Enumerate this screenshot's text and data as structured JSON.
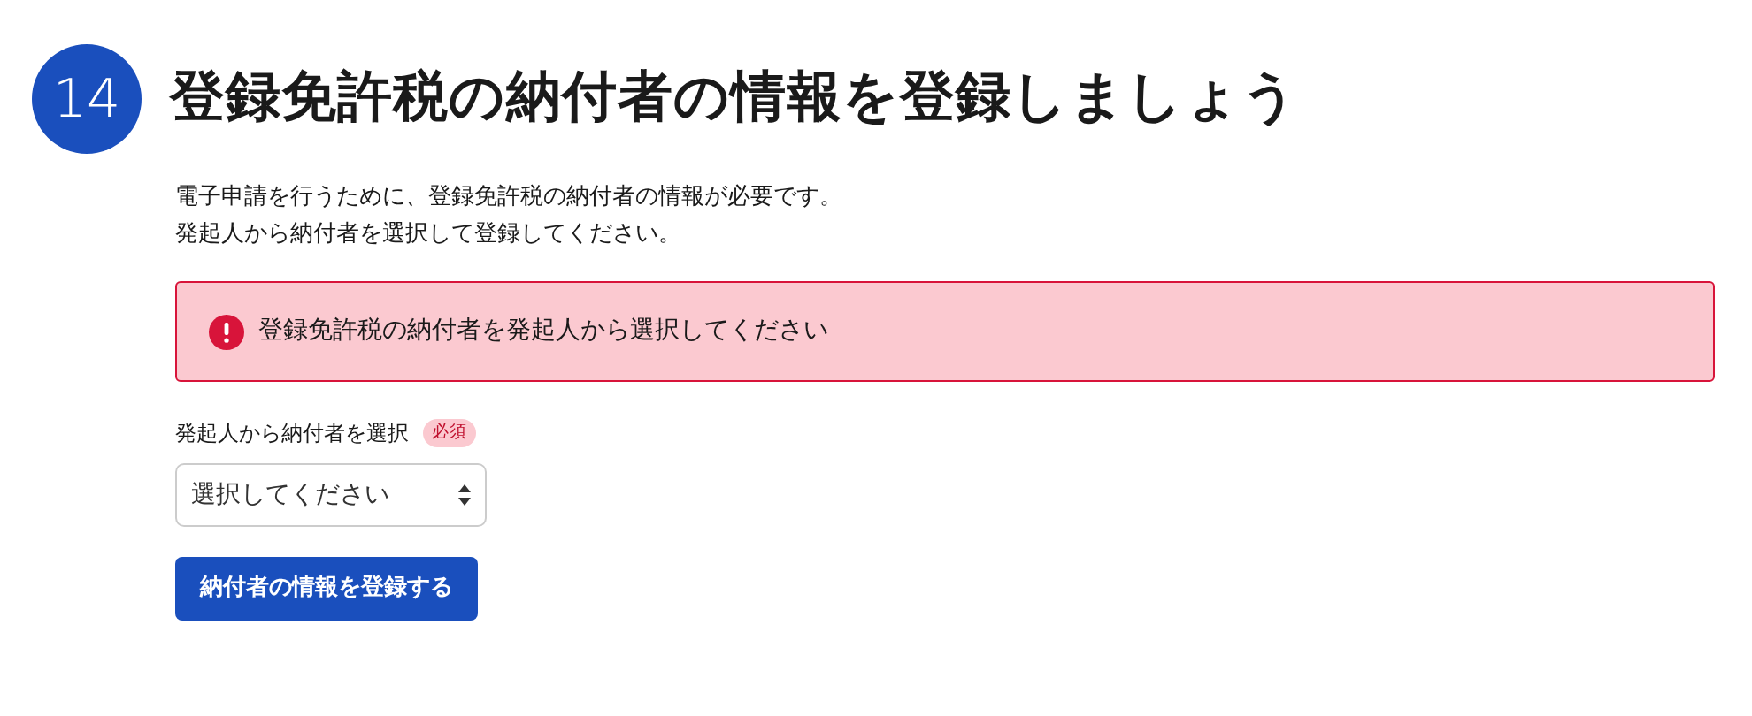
{
  "step": {
    "number": "14",
    "title": "登録免許税の納付者の情報を登録しましょう"
  },
  "description": [
    "電子申請を行うために、登録免許税の納付者の情報が必要です。",
    "発起人から納付者を選択して登録してください。"
  ],
  "alert": {
    "kind": "error",
    "message": "登録免許税の納付者を発起人から選択してください"
  },
  "field": {
    "label": "発起人から納付者を選択",
    "required_badge": "必須",
    "placeholder": "選択してください"
  },
  "submit_button": "納付者の情報を登録する"
}
